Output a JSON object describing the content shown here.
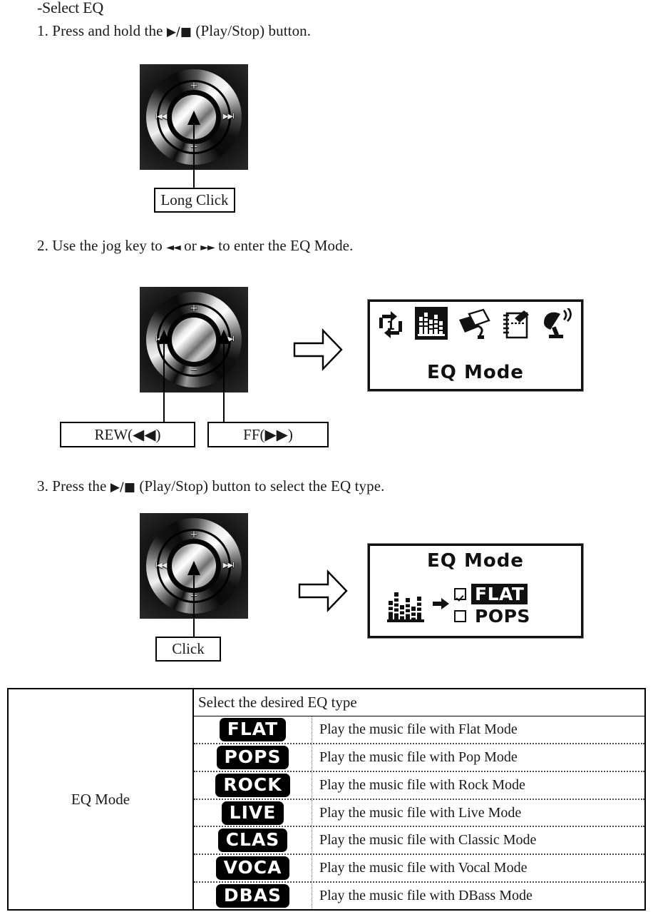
{
  "header": {
    "title": "-Select EQ"
  },
  "steps": {
    "step1": {
      "prefix": "1. Press and hold the",
      "button_glyph": "▶/■",
      "suffix": "(Play/Stop) button."
    },
    "step2": {
      "prefix": "2. Use the jog key to",
      "rew_glyph": "◄◄",
      "middle": "or",
      "ff_glyph": "►►",
      "suffix": "to enter the EQ Mode."
    },
    "step3": {
      "prefix": "3. Press the",
      "button_glyph": "▶/■",
      "suffix": "(Play/Stop) button to select the EQ type."
    }
  },
  "callouts": {
    "long_click": "Long Click",
    "rew": "REW(◀◀)",
    "ff": "FF(▶▶)",
    "click": "Click"
  },
  "device": {
    "mark_plus": "+",
    "mark_minus": "─",
    "mark_rew": "I◀◀",
    "mark_ff": "▶▶I"
  },
  "lcd_menu": {
    "title": "EQ Mode",
    "icons": [
      {
        "name": "repeat-one-icon",
        "selected": false
      },
      {
        "name": "equalizer-icon",
        "selected": true
      },
      {
        "name": "file-browser-icon",
        "selected": false
      },
      {
        "name": "notepad-icon",
        "selected": false
      },
      {
        "name": "radio-icon",
        "selected": false
      }
    ]
  },
  "lcd_eq": {
    "title": "EQ Mode",
    "options": [
      {
        "label": "FLAT",
        "checked": true,
        "selected": true
      },
      {
        "label": "POPS",
        "checked": false,
        "selected": false
      }
    ]
  },
  "table": {
    "row_label": "EQ Mode",
    "caption": "Select the desired EQ type",
    "rows": [
      {
        "badge": "FLAT",
        "desc": "Play the music file with Flat Mode"
      },
      {
        "badge": "POPS",
        "desc": "Play the music file with Pop Mode"
      },
      {
        "badge": "ROCK",
        "desc": "Play the music file with Rock Mode"
      },
      {
        "badge": "LIVE",
        "desc": "Play the music file with Live Mode"
      },
      {
        "badge": "CLAS",
        "desc": "Play the music file with Classic Mode"
      },
      {
        "badge": "VOCA",
        "desc": "Play the music file with Vocal Mode"
      },
      {
        "badge": "DBAS",
        "desc": "Play the music file with DBass Mode"
      }
    ]
  }
}
